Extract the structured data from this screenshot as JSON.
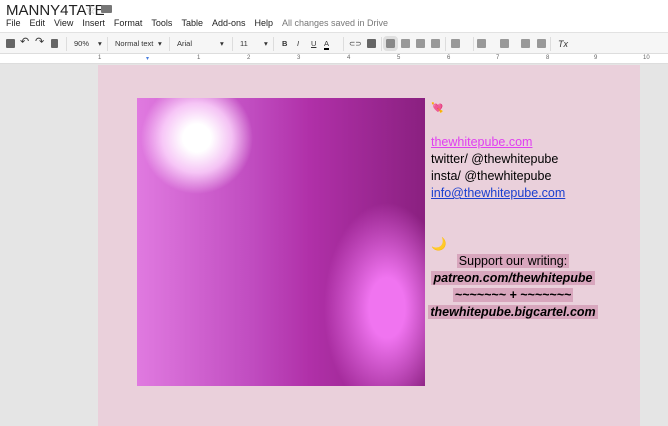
{
  "doc": {
    "title": "MANNY4TATE",
    "status": "All changes saved in Drive"
  },
  "menu": [
    "File",
    "Edit",
    "View",
    "Insert",
    "Format",
    "Tools",
    "Table",
    "Add-ons",
    "Help"
  ],
  "toolbar": {
    "zoom": "90%",
    "style": "Normal text",
    "font": "Arial",
    "size": "11"
  },
  "ruler": [
    "1",
    "1",
    "2",
    "3",
    "4",
    "5",
    "6",
    "7",
    "8",
    "9",
    "10"
  ],
  "content": {
    "emoji_top": "💘",
    "link_site": "thewhitepube.com",
    "twitter": "twitter/ @thewhitepube",
    "insta": "insta/ @thewhitepube",
    "email": "info@thewhitepube.com",
    "emoji_moon": "🌙",
    "support": "Support our writing:",
    "patreon": "patreon.com/thewhitepube",
    "divider": "~~~~~~~ + ~~~~~~~",
    "bigcartel": "thewhitepube.bigcartel.com"
  },
  "colors": {
    "page": "#ead0db",
    "link_pink": "#e040f0",
    "link_blue": "#1a3fcf",
    "highlight": "#d8a6bd"
  }
}
